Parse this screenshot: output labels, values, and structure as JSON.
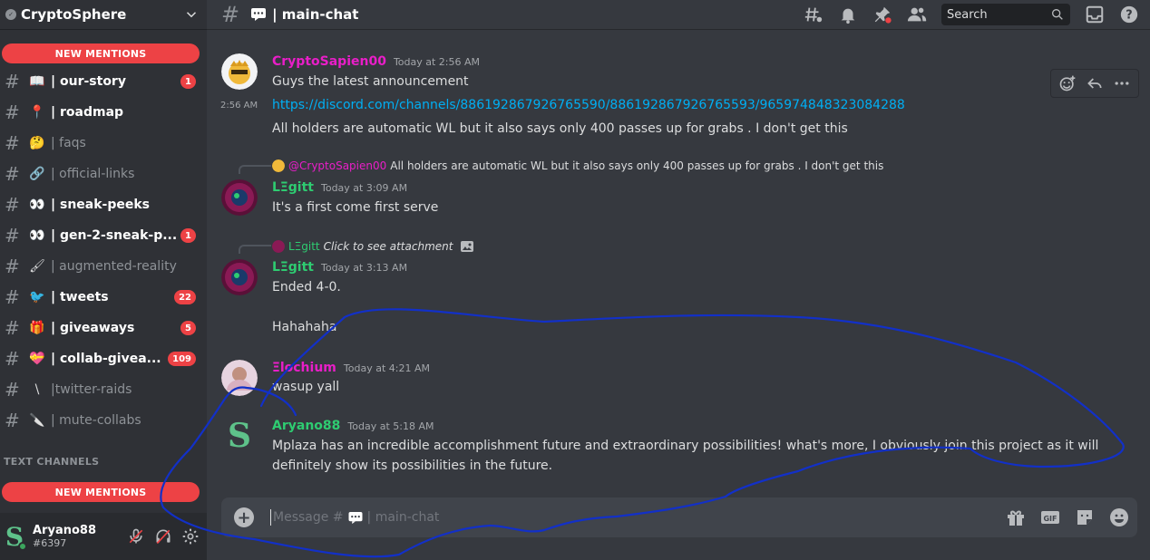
{
  "server": {
    "name": "CryptoSphere",
    "badge_icon": "verified-server-icon"
  },
  "sidebar": {
    "new_mentions_top": "NEW MENTIONS",
    "new_mentions_bottom": "NEW MENTIONS",
    "channels": [
      {
        "emoji": "📖",
        "label": "| our-story",
        "unread": true,
        "badge": "1"
      },
      {
        "emoji": "📍",
        "label": "| roadmap",
        "unread": true,
        "badge": ""
      },
      {
        "emoji": "🤔",
        "label": "| faqs",
        "unread": false,
        "badge": ""
      },
      {
        "emoji": "🔗",
        "label": "| official-links",
        "unread": false,
        "badge": ""
      },
      {
        "emoji": "👀",
        "label": "| sneak-peeks",
        "unread": true,
        "badge": ""
      },
      {
        "emoji": "👀",
        "label": "| gen-2-sneak-p...",
        "unread": true,
        "badge": "1"
      },
      {
        "emoji": "🖌",
        "label": "| augmented-reality",
        "unread": false,
        "badge": ""
      },
      {
        "emoji": "🐦",
        "label": "| tweets",
        "unread": true,
        "badge": "22"
      },
      {
        "emoji": "🎁",
        "label": "| giveaways",
        "unread": true,
        "badge": "5"
      },
      {
        "emoji": "💝",
        "label": "| collab-givea...",
        "unread": true,
        "badge": "109"
      },
      {
        "emoji": "\\",
        "label": "|twitter-raids",
        "unread": false,
        "badge": ""
      },
      {
        "emoji": "🔪",
        "label": "| mute-collabs",
        "unread": false,
        "badge": ""
      }
    ],
    "category_label": "TEXT CHANNELS",
    "user": {
      "name": "Aryano88",
      "tag": "#6397",
      "avatar_letter": "S"
    }
  },
  "topbar": {
    "channel": "| main-chat",
    "search_placeholder": "Search"
  },
  "messages": {
    "m1": {
      "author": "CryptoSapien00",
      "author_color": "#e91ec8",
      "time": "Today at 2:56 AM",
      "line1": "Guys the latest announcement",
      "side_time": "2:56 AM",
      "link": "https://discord.com/channels/886192867926765590/886192867926765593/965974848323084288",
      "line3": "All holders are automatic WL but it also says only 400 passes up for grabs . I don't get this"
    },
    "m2": {
      "reply_author": "@CryptoSapien00",
      "reply_text": "All holders are automatic WL but it also says only 400 passes up for grabs . I don't get this",
      "author": "LΞgitt",
      "author_color": "#2ecc71",
      "time": "Today at 3:09 AM",
      "text": "It's a first come first serve"
    },
    "m3": {
      "reply_author": "LΞgitt",
      "reply_text": "Click to see attachment",
      "author": "LΞgitt",
      "author_color": "#2ecc71",
      "time": "Today at 3:13 AM",
      "line1": "Ended 4-0.",
      "line2": "Hahahaha"
    },
    "m4": {
      "author": "Ξlochium",
      "author_color": "#e91ec8",
      "time": "Today at 4:21 AM",
      "text": "wasup yall"
    },
    "m5": {
      "author": "Aryano88",
      "author_color": "#2ecc71",
      "time": "Today at 5:18 AM",
      "line1": "Mplaza has an incredible accomplishment future and extraordinary possibilities! what's more, I obviously join this project as it will",
      "line2": "definitely show its possibilities in the future."
    }
  },
  "composer": {
    "placeholder_prefix": "Message #",
    "placeholder_channel": "| main-chat"
  },
  "colors": {
    "accent_red": "#ed4245",
    "link": "#00aff4",
    "scribble": "#1230c8"
  }
}
